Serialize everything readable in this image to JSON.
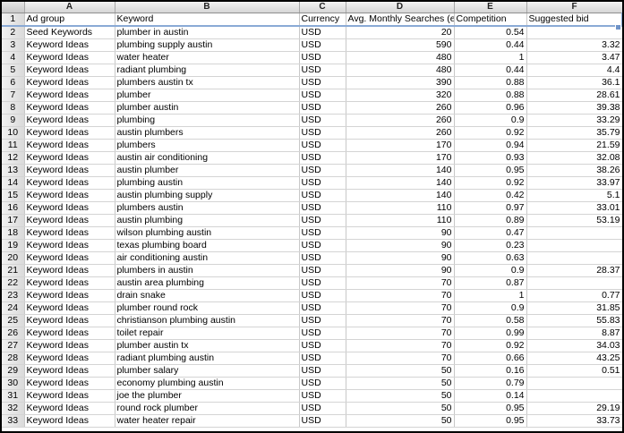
{
  "columns": [
    "A",
    "B",
    "C",
    "D",
    "E",
    "F"
  ],
  "header": {
    "row_number": "1",
    "cells": [
      "Ad group",
      "Keyword",
      "Currency",
      "Avg. Monthly Searches (ex",
      "Competition",
      "Suggested bid"
    ]
  },
  "rows": [
    {
      "n": "2",
      "ad_group": "Seed Keywords",
      "keyword": "plumber in austin",
      "currency": "USD",
      "searches": "20",
      "competition": "0.54",
      "bid": ""
    },
    {
      "n": "3",
      "ad_group": "Keyword Ideas",
      "keyword": "plumbing supply austin",
      "currency": "USD",
      "searches": "590",
      "competition": "0.44",
      "bid": "3.32"
    },
    {
      "n": "4",
      "ad_group": "Keyword Ideas",
      "keyword": "water heater",
      "currency": "USD",
      "searches": "480",
      "competition": "1",
      "bid": "3.47"
    },
    {
      "n": "5",
      "ad_group": "Keyword Ideas",
      "keyword": "radiant plumbing",
      "currency": "USD",
      "searches": "480",
      "competition": "0.44",
      "bid": "4.4"
    },
    {
      "n": "6",
      "ad_group": "Keyword Ideas",
      "keyword": "plumbers austin tx",
      "currency": "USD",
      "searches": "390",
      "competition": "0.88",
      "bid": "36.1"
    },
    {
      "n": "7",
      "ad_group": "Keyword Ideas",
      "keyword": "plumber",
      "currency": "USD",
      "searches": "320",
      "competition": "0.88",
      "bid": "28.61"
    },
    {
      "n": "8",
      "ad_group": "Keyword Ideas",
      "keyword": "plumber austin",
      "currency": "USD",
      "searches": "260",
      "competition": "0.96",
      "bid": "39.38"
    },
    {
      "n": "9",
      "ad_group": "Keyword Ideas",
      "keyword": "plumbing",
      "currency": "USD",
      "searches": "260",
      "competition": "0.9",
      "bid": "33.29"
    },
    {
      "n": "10",
      "ad_group": "Keyword Ideas",
      "keyword": "austin plumbers",
      "currency": "USD",
      "searches": "260",
      "competition": "0.92",
      "bid": "35.79"
    },
    {
      "n": "11",
      "ad_group": "Keyword Ideas",
      "keyword": "plumbers",
      "currency": "USD",
      "searches": "170",
      "competition": "0.94",
      "bid": "21.59"
    },
    {
      "n": "12",
      "ad_group": "Keyword Ideas",
      "keyword": "austin air conditioning",
      "currency": "USD",
      "searches": "170",
      "competition": "0.93",
      "bid": "32.08"
    },
    {
      "n": "13",
      "ad_group": "Keyword Ideas",
      "keyword": "austin plumber",
      "currency": "USD",
      "searches": "140",
      "competition": "0.95",
      "bid": "38.26"
    },
    {
      "n": "14",
      "ad_group": "Keyword Ideas",
      "keyword": "plumbing austin",
      "currency": "USD",
      "searches": "140",
      "competition": "0.92",
      "bid": "33.97"
    },
    {
      "n": "15",
      "ad_group": "Keyword Ideas",
      "keyword": "austin plumbing supply",
      "currency": "USD",
      "searches": "140",
      "competition": "0.42",
      "bid": "5.1"
    },
    {
      "n": "16",
      "ad_group": "Keyword Ideas",
      "keyword": "plumbers austin",
      "currency": "USD",
      "searches": "110",
      "competition": "0.97",
      "bid": "33.01"
    },
    {
      "n": "17",
      "ad_group": "Keyword Ideas",
      "keyword": "austin plumbing",
      "currency": "USD",
      "searches": "110",
      "competition": "0.89",
      "bid": "53.19"
    },
    {
      "n": "18",
      "ad_group": "Keyword Ideas",
      "keyword": "wilson plumbing austin",
      "currency": "USD",
      "searches": "90",
      "competition": "0.47",
      "bid": ""
    },
    {
      "n": "19",
      "ad_group": "Keyword Ideas",
      "keyword": "texas plumbing board",
      "currency": "USD",
      "searches": "90",
      "competition": "0.23",
      "bid": ""
    },
    {
      "n": "20",
      "ad_group": "Keyword Ideas",
      "keyword": "air conditioning austin",
      "currency": "USD",
      "searches": "90",
      "competition": "0.63",
      "bid": ""
    },
    {
      "n": "21",
      "ad_group": "Keyword Ideas",
      "keyword": "plumbers in austin",
      "currency": "USD",
      "searches": "90",
      "competition": "0.9",
      "bid": "28.37"
    },
    {
      "n": "22",
      "ad_group": "Keyword Ideas",
      "keyword": "austin area plumbing",
      "currency": "USD",
      "searches": "70",
      "competition": "0.87",
      "bid": ""
    },
    {
      "n": "23",
      "ad_group": "Keyword Ideas",
      "keyword": "drain snake",
      "currency": "USD",
      "searches": "70",
      "competition": "1",
      "bid": "0.77"
    },
    {
      "n": "24",
      "ad_group": "Keyword Ideas",
      "keyword": "plumber round rock",
      "currency": "USD",
      "searches": "70",
      "competition": "0.9",
      "bid": "31.85"
    },
    {
      "n": "25",
      "ad_group": "Keyword Ideas",
      "keyword": "christianson plumbing austin",
      "currency": "USD",
      "searches": "70",
      "competition": "0.58",
      "bid": "55.83"
    },
    {
      "n": "26",
      "ad_group": "Keyword Ideas",
      "keyword": "toilet repair",
      "currency": "USD",
      "searches": "70",
      "competition": "0.99",
      "bid": "8.87"
    },
    {
      "n": "27",
      "ad_group": "Keyword Ideas",
      "keyword": "plumber austin tx",
      "currency": "USD",
      "searches": "70",
      "competition": "0.92",
      "bid": "34.03"
    },
    {
      "n": "28",
      "ad_group": "Keyword Ideas",
      "keyword": "radiant plumbing austin",
      "currency": "USD",
      "searches": "70",
      "competition": "0.66",
      "bid": "43.25"
    },
    {
      "n": "29",
      "ad_group": "Keyword Ideas",
      "keyword": "plumber salary",
      "currency": "USD",
      "searches": "50",
      "competition": "0.16",
      "bid": "0.51"
    },
    {
      "n": "30",
      "ad_group": "Keyword Ideas",
      "keyword": "economy plumbing austin",
      "currency": "USD",
      "searches": "50",
      "competition": "0.79",
      "bid": ""
    },
    {
      "n": "31",
      "ad_group": "Keyword Ideas",
      "keyword": "joe the plumber",
      "currency": "USD",
      "searches": "50",
      "competition": "0.14",
      "bid": ""
    },
    {
      "n": "32",
      "ad_group": "Keyword Ideas",
      "keyword": "round rock plumber",
      "currency": "USD",
      "searches": "50",
      "competition": "0.95",
      "bid": "29.19"
    },
    {
      "n": "33",
      "ad_group": "Keyword Ideas",
      "keyword": "water heater repair",
      "currency": "USD",
      "searches": "50",
      "competition": "0.95",
      "bid": "33.73"
    }
  ],
  "colors": {
    "selection_border": "#8aaad6",
    "header_bg": "#d6d6d6",
    "gridline": "#d4d4d4"
  }
}
